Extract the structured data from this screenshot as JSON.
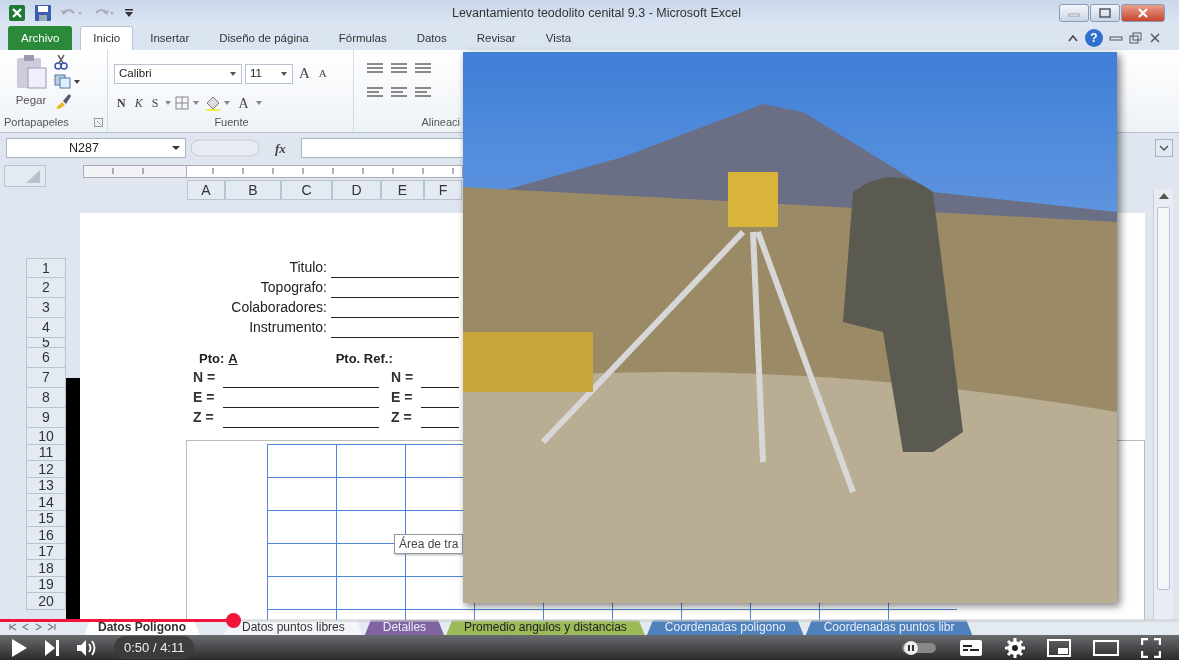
{
  "window": {
    "title": "Levantamiento teodolito cenital 9.3  -  Microsoft Excel"
  },
  "ribbon_tabs": [
    {
      "label": "Archivo",
      "kind": "file",
      "selected": false
    },
    {
      "label": "Inicio",
      "kind": "tab",
      "selected": true
    },
    {
      "label": "Insertar",
      "kind": "tab",
      "selected": false
    },
    {
      "label": "Diseño de página",
      "kind": "tab",
      "selected": false
    },
    {
      "label": "Fórmulas",
      "kind": "tab",
      "selected": false
    },
    {
      "label": "Datos",
      "kind": "tab",
      "selected": false
    },
    {
      "label": "Revisar",
      "kind": "tab",
      "selected": false
    },
    {
      "label": "Vista",
      "kind": "tab",
      "selected": false
    }
  ],
  "help": "?",
  "ribbon": {
    "clipboard": {
      "paste": "Pegar",
      "group": "Portapapeles"
    },
    "font": {
      "name": "Calibri",
      "size": "11",
      "grow": "A",
      "shrink": "A",
      "styles": [
        "N",
        "K",
        "S"
      ],
      "font_color": "A",
      "group": "Fuente"
    },
    "alignment": {
      "group": "Alineaci"
    }
  },
  "formula_bar": {
    "name_box": "N287",
    "fx": "fx"
  },
  "columns": [
    "A",
    "B",
    "C",
    "D",
    "E",
    "F"
  ],
  "rows": [
    "1",
    "2",
    "3",
    "4",
    "5",
    "6",
    "7",
    "8",
    "9",
    "10",
    "11",
    "12",
    "13",
    "14",
    "15",
    "16",
    "17",
    "18",
    "19",
    "20"
  ],
  "form": {
    "header_fields": [
      "Titulo:",
      "Topografo:",
      "Colaboradores:",
      "Instrumento:"
    ],
    "point": {
      "label": "Pto:",
      "value": "A"
    },
    "ref_label": "Pto. Ref.:",
    "coords_left": [
      "N =",
      "E =",
      "Z ="
    ],
    "coords_right": [
      "N =",
      "E =",
      "Z ="
    ]
  },
  "tooltip": "Área de tra",
  "sheet_tabs": [
    {
      "label": "Datos Poligono",
      "selected": true
    },
    {
      "label": "Datos puntos libres",
      "selected": false
    },
    {
      "label": "Detalles",
      "selected": false,
      "color": "#8064a2"
    },
    {
      "label": "Promedio angulos y distancias",
      "selected": false,
      "color": "#9bbb59"
    },
    {
      "label": "Coordenadas poligono",
      "selected": false,
      "color": "#4f81bd"
    },
    {
      "label": "Coordenadas puntos libr",
      "selected": false,
      "color": "#4f81bd"
    }
  ],
  "player": {
    "progress": {
      "level": 0.198
    },
    "time": "0:50 / 4:11"
  }
}
